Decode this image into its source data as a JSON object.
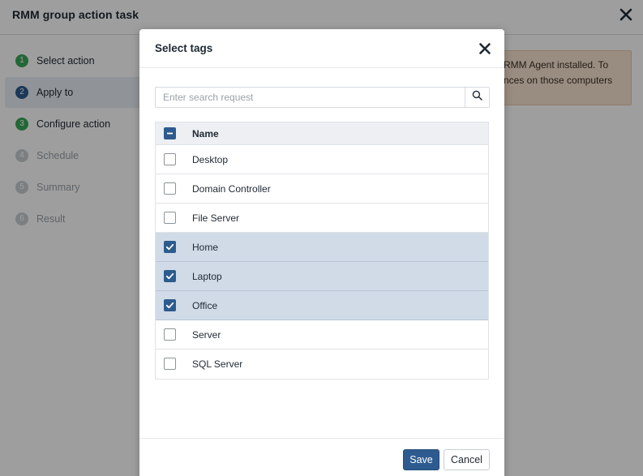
{
  "background": {
    "title": "RMM group action task",
    "steps": [
      {
        "num": "1",
        "label": "Select action"
      },
      {
        "num": "2",
        "label": "Apply to"
      },
      {
        "num": "3",
        "label": "Configure action"
      },
      {
        "num": "4",
        "label": "Schedule"
      },
      {
        "num": "5",
        "label": "Summary"
      },
      {
        "num": "6",
        "label": "Result"
      }
    ],
    "notice": {
      "line1": "RMM Agent installed. To",
      "line2": "nces on those computers"
    }
  },
  "modal": {
    "title": "Select tags",
    "search": {
      "placeholder": "Enter search request",
      "value": ""
    },
    "table": {
      "header": "Name",
      "header_checkbox_state": "indeterminate",
      "rows": [
        {
          "name": "Desktop",
          "checked": false
        },
        {
          "name": "Domain Controller",
          "checked": false
        },
        {
          "name": "File Server",
          "checked": false
        },
        {
          "name": "Home",
          "checked": true
        },
        {
          "name": "Laptop",
          "checked": true
        },
        {
          "name": "Office",
          "checked": true
        },
        {
          "name": "Server",
          "checked": false
        },
        {
          "name": "SQL Server",
          "checked": false
        }
      ]
    },
    "save_label": "Save",
    "cancel_label": "Cancel"
  },
  "colors": {
    "accent": "#2d5b8f",
    "step_done": "#3aa657",
    "selected_row": "#d0dbe7",
    "notice_bg": "#f7e3cf"
  },
  "icons": {
    "close": "close-icon",
    "search": "search-icon",
    "check": "checkmark-icon",
    "indeterminate": "minus-icon"
  }
}
